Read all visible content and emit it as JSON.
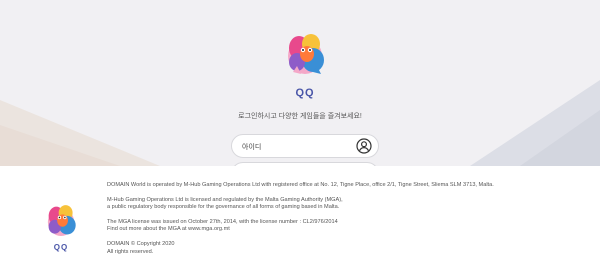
{
  "brand": {
    "logo_text": "QQ",
    "footer_logo_text": "QQ"
  },
  "login": {
    "tagline": "로그인하시고 다양한 게임들을 즐겨보세요!",
    "id_placeholder": "아이디"
  },
  "footer": {
    "operator": "DOMAIN World is operated by M-Hub Gaming Operations Ltd with registered office at No. 12, Tigne Place, office 2/1, Tigne Street, Sliema SLM 3713, Malta.",
    "license_line1": "M-Hub Gaming Operations Ltd is licensed and regulated by the Malta Gaming Authority (MGA),",
    "license_line2": "a public regulatory body responsible for the governance of all forms of gaming based in Malta.",
    "mga_line1": "The MGA license was issued on October 27th, 2014, with the license number : CL2/976/2014",
    "mga_line2": "Find out more about the MGA at www.mga.org.mt",
    "copyright": "DOMAIN © Copyright 2020",
    "rights": "All rights reserved."
  },
  "colors": {
    "accent": "#4a56a8",
    "background": "#f1f0f3"
  },
  "icons": {
    "user": "user-circle-icon"
  }
}
